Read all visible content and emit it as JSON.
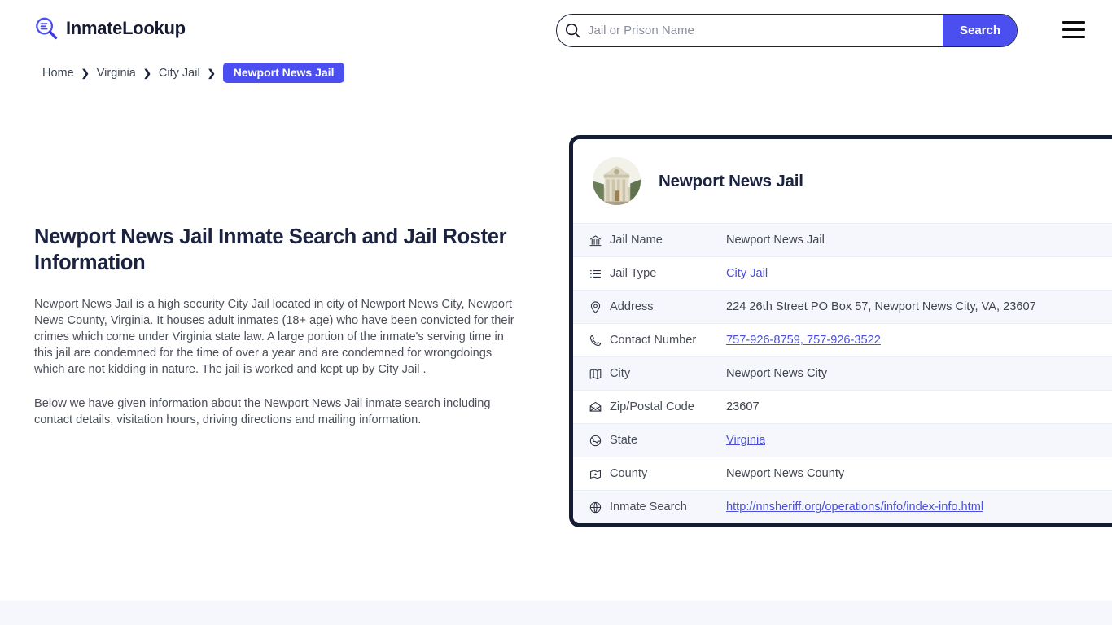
{
  "header": {
    "brand_name": "InmateLookup",
    "brand_icon": "magnifier-list-icon",
    "search": {
      "placeholder": "Jail or Prison Name",
      "value": "",
      "icon": "search-icon",
      "button_label": "Search"
    },
    "menu_icon": "hamburger-menu-icon",
    "accent_color": "#4b4ff0"
  },
  "breadcrumb": {
    "items": [
      {
        "label": "Home",
        "current": false
      },
      {
        "label": "Virginia",
        "current": false
      },
      {
        "label": "City Jail",
        "current": false
      },
      {
        "label": "Newport News Jail",
        "current": true
      }
    ],
    "separator": "❯"
  },
  "main": {
    "title": "Newport News Jail Inmate Search and Jail Roster Information",
    "paragraphs": [
      "Newport News Jail is a high security City Jail located in city of Newport News City, Newport News County, Virginia. It houses adult inmates (18+ age) who have been convicted for their crimes which come under Virginia state law. A large portion of the inmate's serving time in this jail are condemned for the time of over a year and are condemned for wrongdoings which are not kidding in nature. The jail is worked and kept up by City Jail .",
      "Below we have given information about the Newport News Jail inmate search including contact details, visitation hours, driving directions and mailing information."
    ]
  },
  "info_card": {
    "title": "Newport News Jail",
    "avatar_icon": "courthouse-photo",
    "border_color": "#141c36",
    "rows": [
      {
        "icon": "bank-building-icon",
        "label": "Jail Name",
        "value": "Newport News Jail",
        "link": false
      },
      {
        "icon": "list-icon",
        "label": "Jail Type",
        "value": "City Jail",
        "link": true
      },
      {
        "icon": "map-pin-icon",
        "label": "Address",
        "value": "224 26th Street PO Box 57, Newport News City, VA, 23607",
        "link": false
      },
      {
        "icon": "phone-icon",
        "label": "Contact Number",
        "value": "757-926-8759, 757-926-3522",
        "link": true
      },
      {
        "icon": "map-icon",
        "label": "City",
        "value": "Newport News City",
        "link": false
      },
      {
        "icon": "envelope-icon",
        "label": "Zip/Postal Code",
        "value": "23607",
        "link": false
      },
      {
        "icon": "globe-icon",
        "label": "State",
        "value": "Virginia",
        "link": true
      },
      {
        "icon": "county-map-icon",
        "label": "County",
        "value": "Newport News County",
        "link": false
      },
      {
        "icon": "globe-grid-icon",
        "label": "Inmate Search",
        "value": "http://nnsheriff.org/operations/info/index-info.html",
        "link": true
      }
    ]
  }
}
